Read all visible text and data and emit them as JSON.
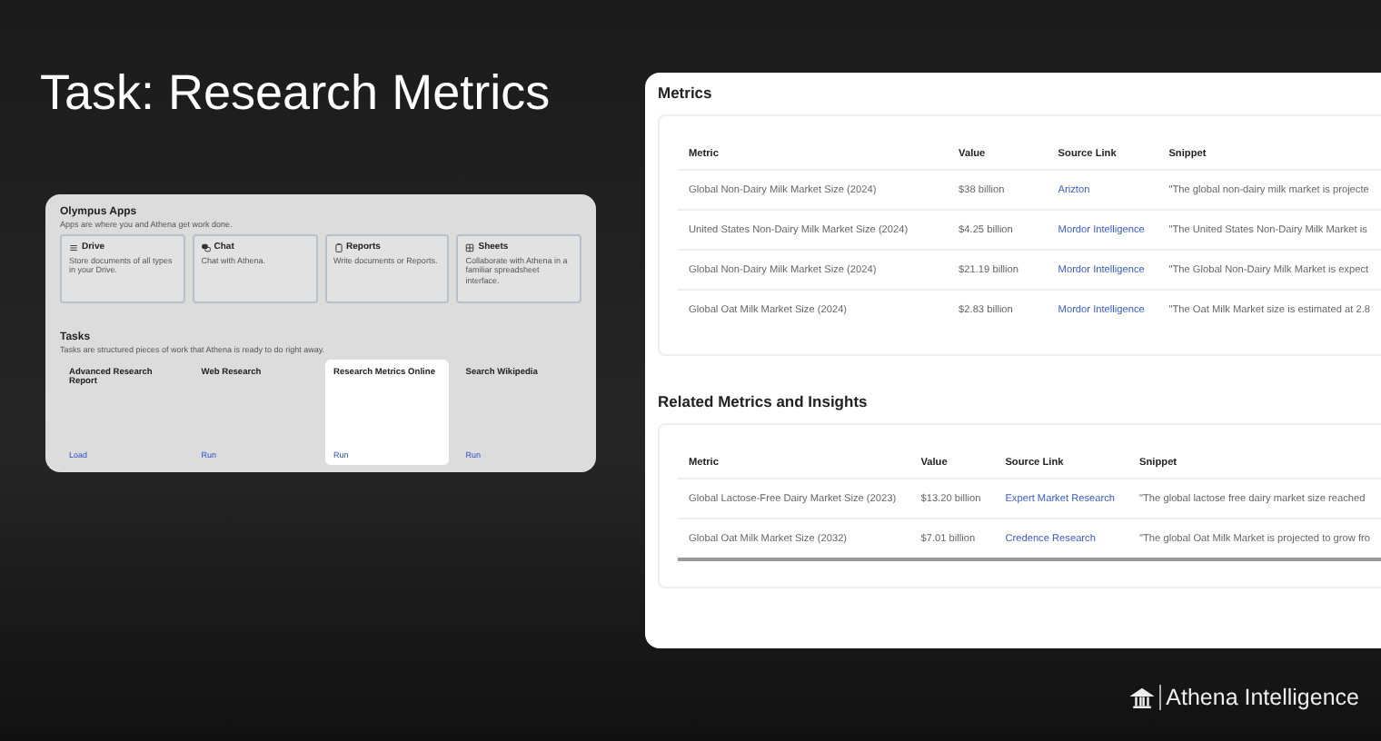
{
  "title": "Task: Research Metrics",
  "apps_panel": {
    "title": "Olympus Apps",
    "subtitle": "Apps are where you and Athena get work done.",
    "apps": [
      {
        "kind": "drive",
        "name": "Drive",
        "description": "Store documents of all types in your Drive."
      },
      {
        "kind": "chat",
        "name": "Chat",
        "description": "Chat with Athena."
      },
      {
        "kind": "reports",
        "name": "Reports",
        "description": "Write documents or Reports."
      },
      {
        "kind": "sheets",
        "name": "Sheets",
        "description": "Collaborate with Athena in a familiar spreadsheet interface."
      }
    ],
    "tasks_title": "Tasks",
    "tasks_subtitle": "Tasks are structured pieces of work that Athena is ready to do right away.",
    "tasks": [
      {
        "name": "Advanced Research Report",
        "action": "Load",
        "selected": false
      },
      {
        "name": "Web Research",
        "action": "Run",
        "selected": false
      },
      {
        "name": "Research Metrics Online",
        "action": "Run",
        "selected": true
      },
      {
        "name": "Search Wikipedia",
        "action": "Run",
        "selected": false
      }
    ]
  },
  "sections": [
    {
      "title": "Metrics",
      "columns": [
        "Metric",
        "Value",
        "Source Link",
        "Snippet"
      ],
      "rows": [
        [
          "Global Non-Dairy Milk Market Size (2024)",
          "$38 billion",
          "Arizton",
          "\"The global non-dairy milk market is projecte"
        ],
        [
          "United States Non-Dairy Milk Market Size (2024)",
          "$4.25 billion",
          "Mordor Intelligence",
          "\"The United States Non-Dairy Milk Market is"
        ],
        [
          "Global Non-Dairy Milk Market Size (2024)",
          "$21.19 billion",
          "Mordor Intelligence",
          "\"The Global Non-Dairy Milk Market is expect"
        ],
        [
          "Global Oat Milk Market Size (2024)",
          "$2.83 billion",
          "Mordor Intelligence",
          "\"The Oat Milk Market size is estimated at 2.8"
        ]
      ]
    },
    {
      "title": "Related Metrics and Insights",
      "columns": [
        "Metric",
        "Value",
        "Source Link",
        "Snippet"
      ],
      "rows": [
        [
          "Global Lactose-Free Dairy Market Size (2023)",
          "$13.20 billion",
          "Expert Market Research",
          "\"The global lactose free dairy market size reached"
        ],
        [
          "Global Oat Milk Market Size (2032)",
          "$7.01 billion",
          "Credence Research",
          "\"The global Oat Milk Market is projected to grow fro"
        ]
      ]
    }
  ],
  "brand": "Athena Intelligence"
}
